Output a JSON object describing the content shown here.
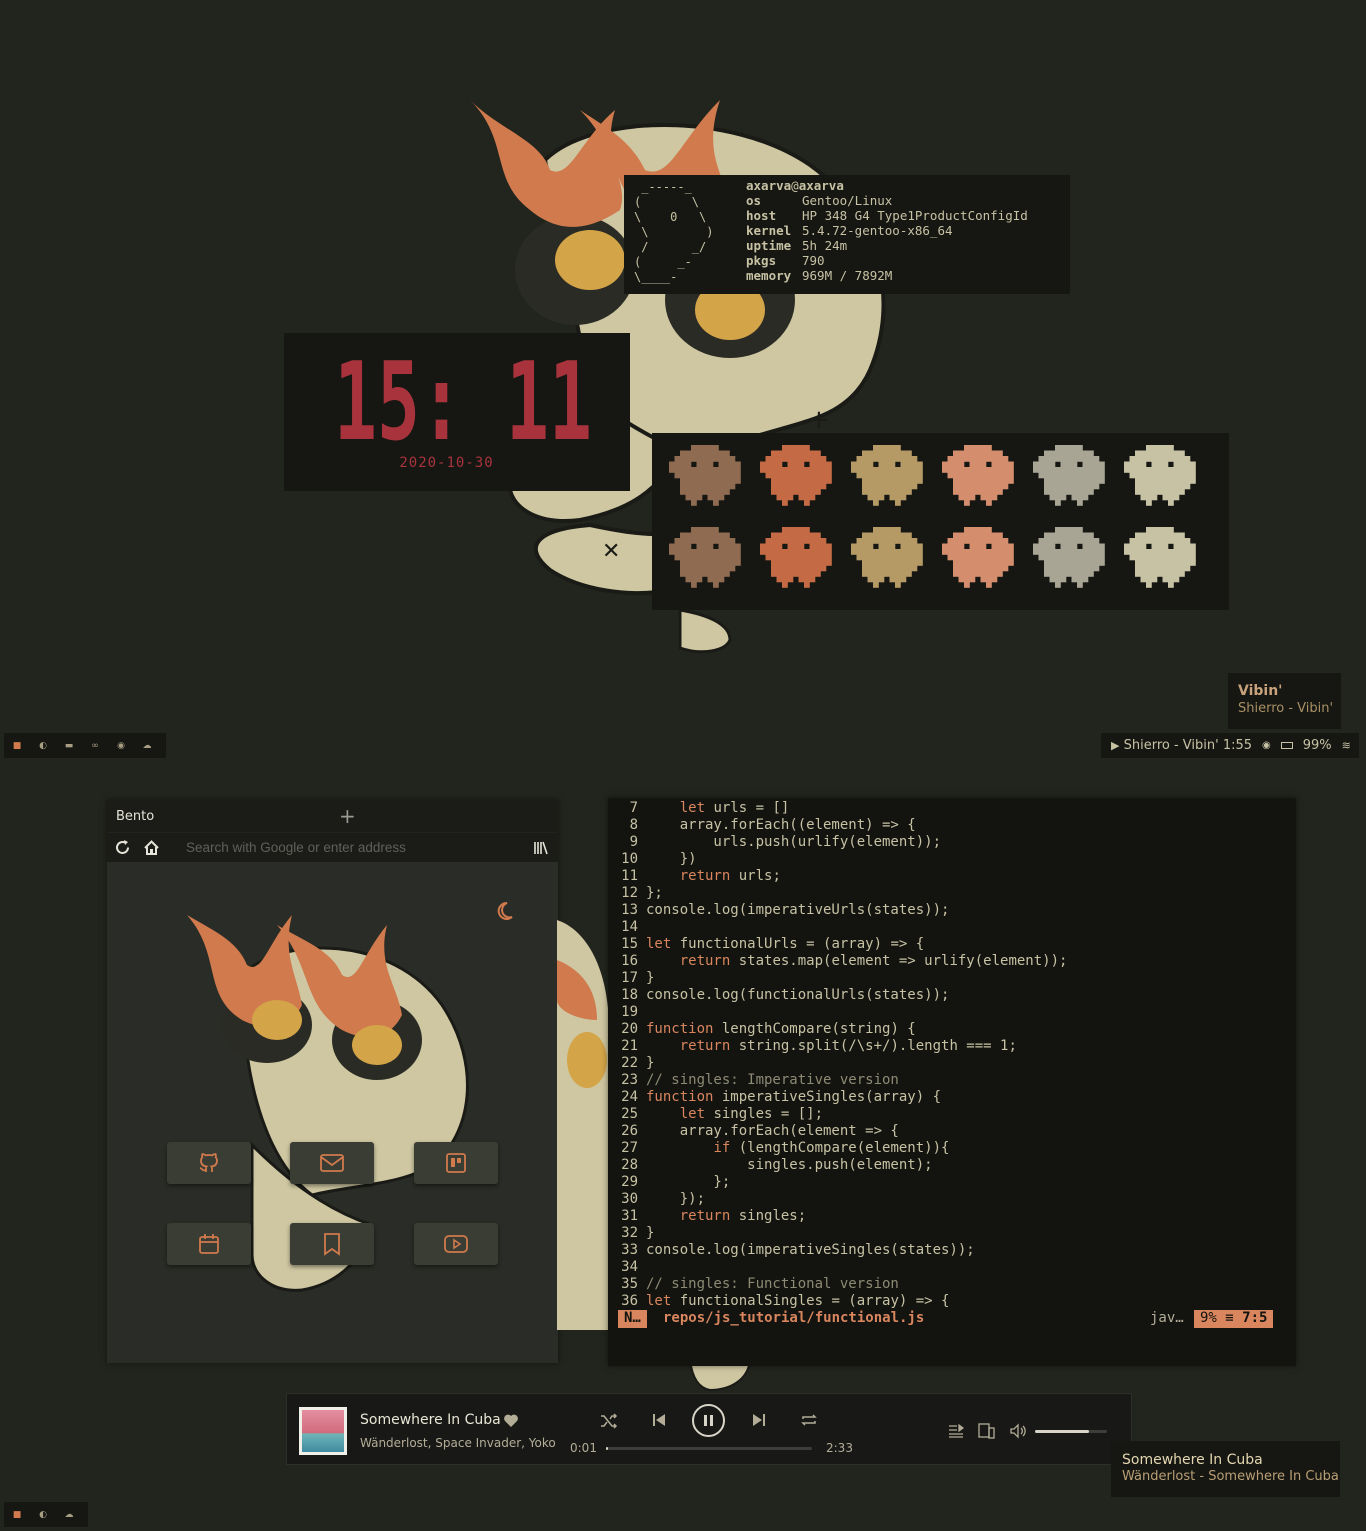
{
  "fetch": {
    "user": "axarva",
    "at": "@",
    "host_name": "axarva",
    "rows": [
      {
        "key": "os",
        "value": "Gentoo/Linux"
      },
      {
        "key": "host",
        "value": "HP 348 G4 Type1ProductConfigId"
      },
      {
        "key": "kernel",
        "value": "5.4.72-gentoo-x86_64"
      },
      {
        "key": "uptime",
        "value": "5h 24m"
      },
      {
        "key": "pkgs",
        "value": "790"
      },
      {
        "key": "memory",
        "value": "969M / 7892M"
      }
    ]
  },
  "clock": {
    "time": "15: 11",
    "date": "2020-10-30",
    "color": "#a8333c"
  },
  "ghosts": {
    "colors": [
      "#8f6b51",
      "#c46a45",
      "#b59a66",
      "#d48d6d",
      "#a8a594",
      "#c7c2a4"
    ]
  },
  "left_bar": {
    "icons": [
      "app-icon",
      "moon-icon",
      "folder-icon",
      "link-icon",
      "music-icon",
      "cloud-icon"
    ]
  },
  "right_bar": {
    "now_playing": "Shierro - Vibin' 1:55",
    "play_glyph": "▶",
    "battery": "99%"
  },
  "vibin_notification": {
    "title": "Vibin'",
    "subtitle": "Shierro - Vibin'"
  },
  "browser": {
    "tab_title": "Bento",
    "new_tab": "+",
    "url_placeholder": "Search with Google or enter address",
    "tiles": [
      "github-icon",
      "mail-icon",
      "trello-icon",
      "calendar-icon",
      "bookmark-icon",
      "youtube-icon"
    ]
  },
  "editor": {
    "lines": [
      {
        "n": "7",
        "t": "    let urls = []"
      },
      {
        "n": "8",
        "t": "    array.forEach((element) => {"
      },
      {
        "n": "9",
        "t": "        urls.push(urlify(element));"
      },
      {
        "n": "10",
        "t": "    })"
      },
      {
        "n": "11",
        "t": "    return urls;"
      },
      {
        "n": "12",
        "t": "};"
      },
      {
        "n": "13",
        "t": "console.log(imperativeUrls(states));"
      },
      {
        "n": "14",
        "t": ""
      },
      {
        "n": "15",
        "t": "let functionalUrls = (array) => {"
      },
      {
        "n": "16",
        "t": "    return states.map(element => urlify(element));"
      },
      {
        "n": "17",
        "t": "}"
      },
      {
        "n": "18",
        "t": "console.log(functionalUrls(states));"
      },
      {
        "n": "19",
        "t": ""
      },
      {
        "n": "20",
        "t": "function lengthCompare(string) {"
      },
      {
        "n": "21",
        "t": "    return string.split(/\\s+/).length === 1;"
      },
      {
        "n": "22",
        "t": "}"
      },
      {
        "n": "23",
        "t": "// singles: Imperative version"
      },
      {
        "n": "24",
        "t": "function imperativeSingles(array) {"
      },
      {
        "n": "25",
        "t": "    let singles = [];"
      },
      {
        "n": "26",
        "t": "    array.forEach(element => {"
      },
      {
        "n": "27",
        "t": "        if (lengthCompare(element)){"
      },
      {
        "n": "28",
        "t": "            singles.push(element);"
      },
      {
        "n": "29",
        "t": "        };"
      },
      {
        "n": "30",
        "t": "    });"
      },
      {
        "n": "31",
        "t": "    return singles;"
      },
      {
        "n": "32",
        "t": "}"
      },
      {
        "n": "33",
        "t": "console.log(imperativeSingles(states));"
      },
      {
        "n": "34",
        "t": ""
      },
      {
        "n": "35",
        "t": "// singles: Functional version"
      },
      {
        "n": "36",
        "t": "let functionalSingles = (array) => {"
      }
    ],
    "mode": "N…",
    "file": "repos/js_tutorial/functional.js",
    "filetype": "jav…",
    "percent": "9%",
    "position": "7:5"
  },
  "player": {
    "title": "Somewhere In Cuba",
    "artists": "Wänderlost, Space Invader, Yokomeshi",
    "elapsed": "0:01",
    "duration": "2:33",
    "progress": 0.01,
    "volume": 0.75
  },
  "song_notification": {
    "title": "Somewhere In Cuba",
    "subtitle": "Wänderlost - Somewhere In Cuba"
  },
  "bottom_bar": {
    "icons": [
      "app-icon",
      "moon-icon",
      "cloud-icon"
    ]
  }
}
